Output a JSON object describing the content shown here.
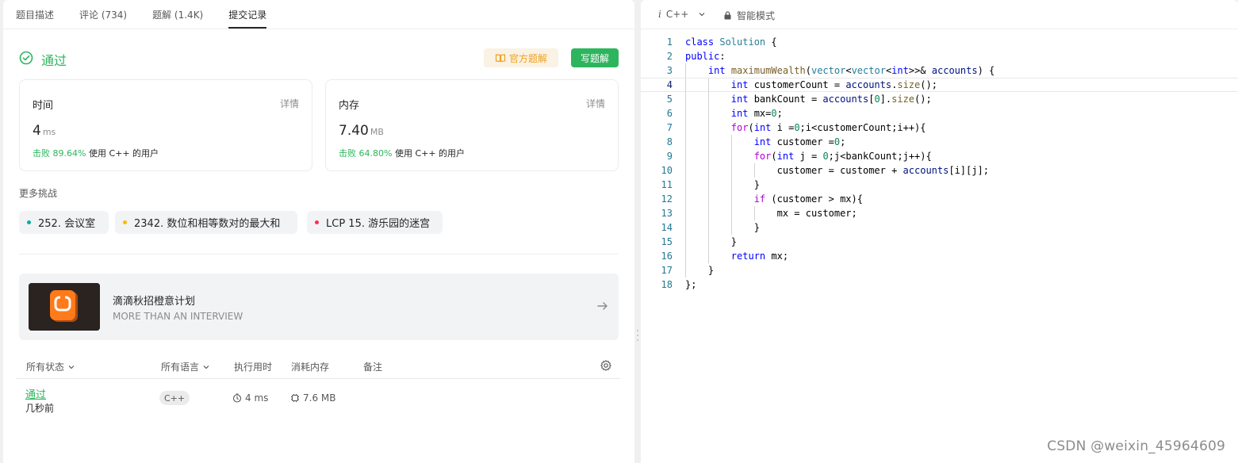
{
  "tabs": [
    {
      "label": "题目描述"
    },
    {
      "label": "评论 (734)"
    },
    {
      "label": "题解 (1.4K)"
    },
    {
      "label": "提交记录"
    }
  ],
  "result": {
    "status": "通过",
    "official_solution_label": "官方题解",
    "write_solution_label": "写题解"
  },
  "runtime_card": {
    "title": "时间",
    "detail": "详情",
    "value": "4",
    "unit": "ms",
    "beat_prefix": "击败",
    "beat_percent": "89.64%",
    "beat_suffix": "使用 C++ 的用户"
  },
  "memory_card": {
    "title": "内存",
    "detail": "详情",
    "value": "7.40",
    "unit": "MB",
    "beat_prefix": "击败",
    "beat_percent": "64.80%",
    "beat_suffix": "使用 C++ 的用户"
  },
  "more_challenges": {
    "title": "更多挑战",
    "items": [
      {
        "label": "252. 会议室",
        "color": "#00af9b"
      },
      {
        "label": "2342. 数位和相等数对的最大和",
        "color": "#ffb800"
      },
      {
        "label": "LCP 15. 游乐园的迷宫",
        "color": "#ff2d55"
      }
    ]
  },
  "banner": {
    "title": "滴滴秋招橙意计划",
    "subtitle": "MORE THAN AN INTERVIEW"
  },
  "submissions": {
    "headers": {
      "status": "所有状态",
      "language": "所有语言",
      "runtime": "执行用时",
      "memory": "消耗内存",
      "notes": "备注"
    },
    "rows": [
      {
        "status": "通过",
        "time": "几秒前",
        "language": "C++",
        "runtime": "4 ms",
        "memory": "7.6 MB"
      }
    ]
  },
  "editor": {
    "language": "C++",
    "language_icon": "i",
    "mode": "智能模式",
    "current_line": 4,
    "lines": [
      "class Solution {",
      "public:",
      "    int maximumWealth(vector<vector<int>>& accounts) {",
      "        int customerCount = accounts.size();",
      "        int bankCount = accounts[0].size();",
      "        int mx=0;",
      "        for(int i =0;i<customerCount;i++){",
      "            int customer =0;",
      "            for(int j = 0;j<bankCount;j++){",
      "                customer = customer + accounts[i][j];",
      "            }",
      "            if (customer > mx){",
      "                mx = customer;",
      "            }",
      "        }",
      "        return mx;",
      "    }",
      "};"
    ]
  },
  "watermark": "CSDN @weixin_45964609",
  "colors": {
    "accent_green": "#2db55d",
    "official_orange": "#f0a020",
    "keyword_blue": "#0000ff",
    "type_teal": "#267f99",
    "control_purple": "#af00db",
    "number_green": "#098658"
  }
}
